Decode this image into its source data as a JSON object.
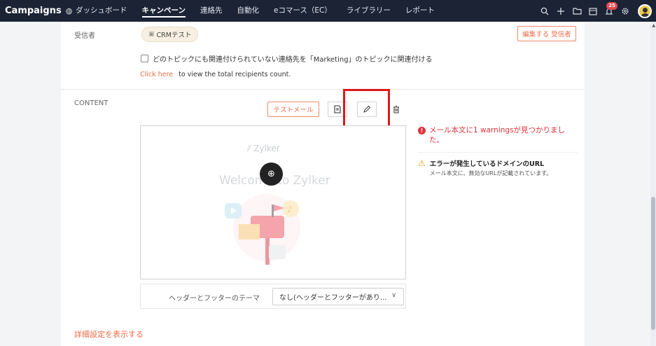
{
  "app": {
    "brand": "Campaigns"
  },
  "nav": {
    "items": [
      {
        "label": "ダッシュボード"
      },
      {
        "label": "キャンペーン"
      },
      {
        "label": "連絡先"
      },
      {
        "label": "自動化"
      },
      {
        "label": "eコマース（EC）"
      },
      {
        "label": "ライブラリー"
      },
      {
        "label": "レポート"
      }
    ],
    "active": "キャンペーン"
  },
  "toolbar": {
    "notification_count": "25"
  },
  "recipients": {
    "label": "受信者",
    "tag": "CRMテスト",
    "edit_button": "編集する 受信者",
    "checkbox_text": "どのトピックにも関連付けられていない連絡先を「Marketing」のトピックに関連付ける",
    "link_text": "Click here",
    "info_text": "to view the total recipients count."
  },
  "content": {
    "label": "CONTENT",
    "test_mail_button": "テストメール",
    "preview": {
      "logo_text": "Zylker",
      "welcome_text": "Welcome to Zylker"
    },
    "footer_theme_label": "ヘッダーとフッターのテーマ",
    "footer_theme_value": "なし(ヘッダーとフッターがあり..."
  },
  "warnings": {
    "error_text": "メール本文に1 warningsが見つかりました。",
    "error_icon": "!",
    "item_title": "エラーが発生しているドメインのURL",
    "item_desc": "メール本文に、無効なURLが記載されています。"
  },
  "advanced_link": "詳細設定を表示する",
  "colors": {
    "accent": "#ee6c4a",
    "topbar": "#1b2335",
    "error": "#e0333a",
    "highlight": "#e0171a"
  }
}
